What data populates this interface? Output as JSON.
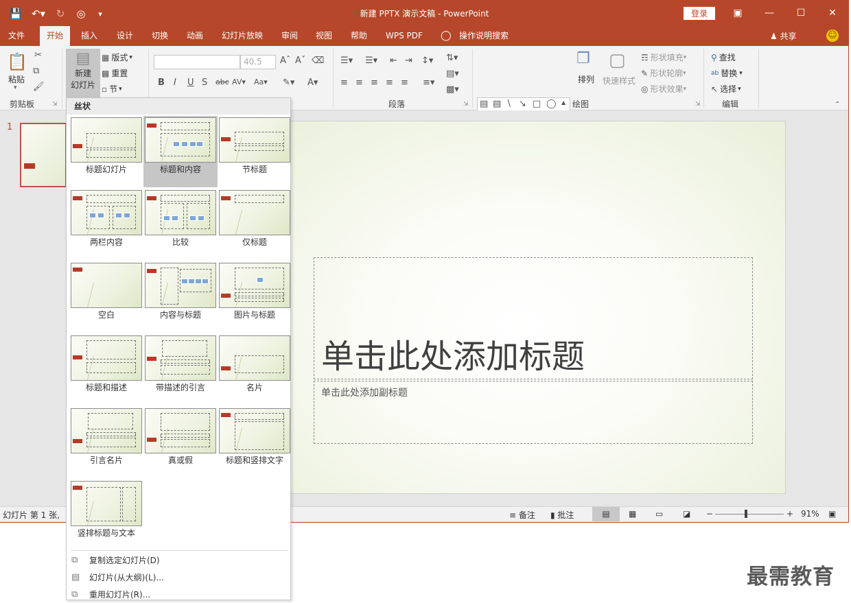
{
  "app": {
    "title": "新建 PPTX 演示文稿 - PowerPoint",
    "login": "登录",
    "share": "共享",
    "brand_color": "#b7472a"
  },
  "quick_access": [
    "save-icon",
    "undo-icon",
    "redo-icon",
    "start-from-beginning-icon",
    "customize-icon"
  ],
  "window_controls": [
    "ribbon-display-icon",
    "minimize-icon",
    "maximize-icon",
    "close-icon"
  ],
  "tabs": [
    {
      "label": "文件"
    },
    {
      "label": "开始"
    },
    {
      "label": "插入"
    },
    {
      "label": "设计"
    },
    {
      "label": "切换"
    },
    {
      "label": "动画"
    },
    {
      "label": "幻灯片放映"
    },
    {
      "label": "审阅"
    },
    {
      "label": "视图"
    },
    {
      "label": "帮助"
    },
    {
      "label": "WPS PDF"
    },
    {
      "label": "操作说明搜索"
    }
  ],
  "active_tab": "开始",
  "ribbon": {
    "clipboard": {
      "label": "剪贴板",
      "paste": "粘贴"
    },
    "slides": {
      "new_slide": "新建",
      "new_slide2": "幻灯片",
      "layout": "版式",
      "reset": "重置",
      "section": "节"
    },
    "font": {
      "font_name": "",
      "font_size": "40.5"
    },
    "paragraph": {
      "label": "段落"
    },
    "drawing": {
      "label": "绘图",
      "arrange": "排列",
      "quick_styles": "快速样式",
      "shape_fill": "形状填充",
      "shape_outline": "形状轮廓",
      "shape_effects": "形状效果"
    },
    "editing": {
      "label": "编辑",
      "find": "查找",
      "replace": "替换",
      "select": "选择"
    }
  },
  "slide_panel": {
    "number": "1"
  },
  "slide": {
    "title_placeholder": "单击此处添加标题",
    "subtitle_placeholder": "单击此处添加副标题"
  },
  "status": {
    "slide_info": "幻灯片 第 1 张, ",
    "notes": "备注",
    "comments": "批注",
    "zoom": "91%",
    "zoom_minus": "−",
    "zoom_plus": "+"
  },
  "layout_menu": {
    "theme": "丝状",
    "layouts": [
      {
        "label": "标题幻灯片"
      },
      {
        "label": "标题和内容"
      },
      {
        "label": "节标题"
      },
      {
        "label": "两栏内容"
      },
      {
        "label": "比较"
      },
      {
        "label": "仅标题"
      },
      {
        "label": "空白"
      },
      {
        "label": "内容与标题"
      },
      {
        "label": "图片与标题"
      },
      {
        "label": "标题和描述"
      },
      {
        "label": "带描述的引言"
      },
      {
        "label": "名片"
      },
      {
        "label": "引言名片"
      },
      {
        "label": "真或假"
      },
      {
        "label": "标题和竖排文字"
      },
      {
        "label": "竖排标题与文本"
      }
    ],
    "selected": "标题和内容",
    "actions": [
      {
        "label": "复制选定幻灯片(D)"
      },
      {
        "label": "幻灯片(从大纲)(L)..."
      },
      {
        "label": "重用幻灯片(R)..."
      }
    ]
  },
  "watermark": "最需教育"
}
